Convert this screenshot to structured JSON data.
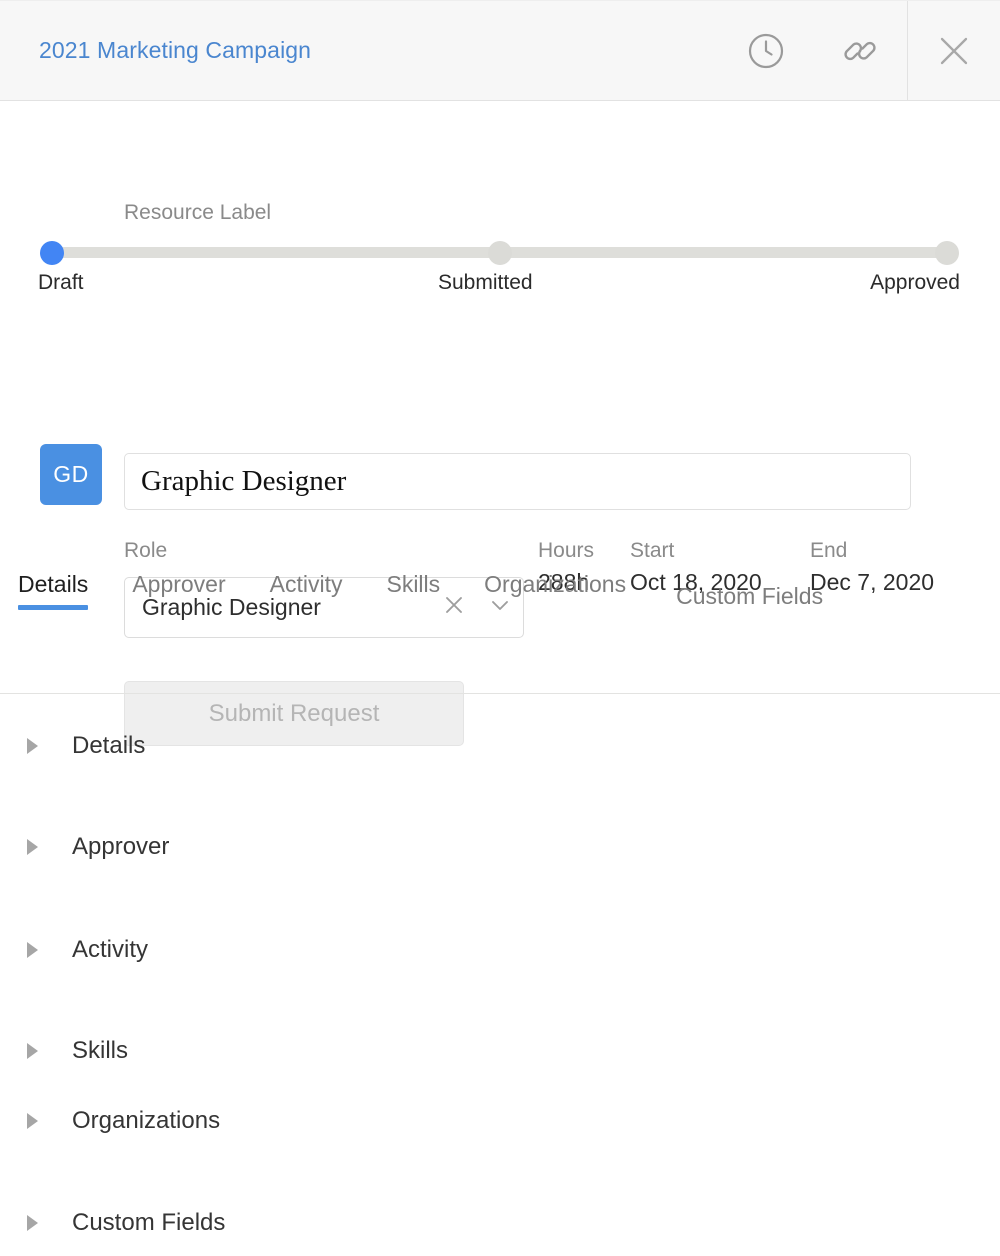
{
  "header": {
    "title": "2021 Marketing Campaign",
    "title_color": "#4a86cf",
    "actions": [
      {
        "name": "history-icon",
        "label": "History"
      },
      {
        "name": "link-icon",
        "label": "Copy link"
      },
      {
        "name": "close-icon",
        "label": "Close"
      }
    ]
  },
  "stepper": {
    "active_color": "#4285f4",
    "inactive_color": "#dbdbd7",
    "steps": [
      {
        "label": "Draft",
        "state": "active"
      },
      {
        "label": "Submitted",
        "state": "inactive"
      },
      {
        "label": "Approved",
        "state": "inactive"
      }
    ]
  },
  "form": {
    "avatar": {
      "initials": "GD",
      "color": "#4a90e2"
    },
    "resource_label": {
      "label": "Resource Label",
      "value": "Graphic Designer",
      "placeholder": "Resource Label"
    },
    "role": {
      "label": "Role",
      "value": "Graphic Designer",
      "placeholder": "Select role"
    },
    "hours": {
      "label": "Hours",
      "value": "288h"
    },
    "start": {
      "label": "Start",
      "value": "Oct 18, 2020"
    },
    "end": {
      "label": "End",
      "value": "Dec 7, 2020"
    },
    "submit_button": {
      "label": "Submit Request",
      "disabled": true
    }
  },
  "tabs": {
    "active_color": "#4a90e2",
    "items": [
      {
        "label": "Details",
        "active": true
      },
      {
        "label": "Approver",
        "active": false
      },
      {
        "label": "Activity",
        "active": false
      },
      {
        "label": "Skills",
        "active": false
      },
      {
        "label": "Organizations",
        "active": false
      },
      {
        "label": "Custom Fields",
        "active": false
      }
    ]
  },
  "accordion": {
    "sections": [
      {
        "label": "Details",
        "expanded": false
      },
      {
        "label": "Approver",
        "expanded": false
      },
      {
        "label": "Activity",
        "expanded": false
      },
      {
        "label": "Skills",
        "expanded": false
      },
      {
        "label": "Organizations",
        "expanded": false
      },
      {
        "label": "Custom Fields",
        "expanded": false
      }
    ]
  }
}
